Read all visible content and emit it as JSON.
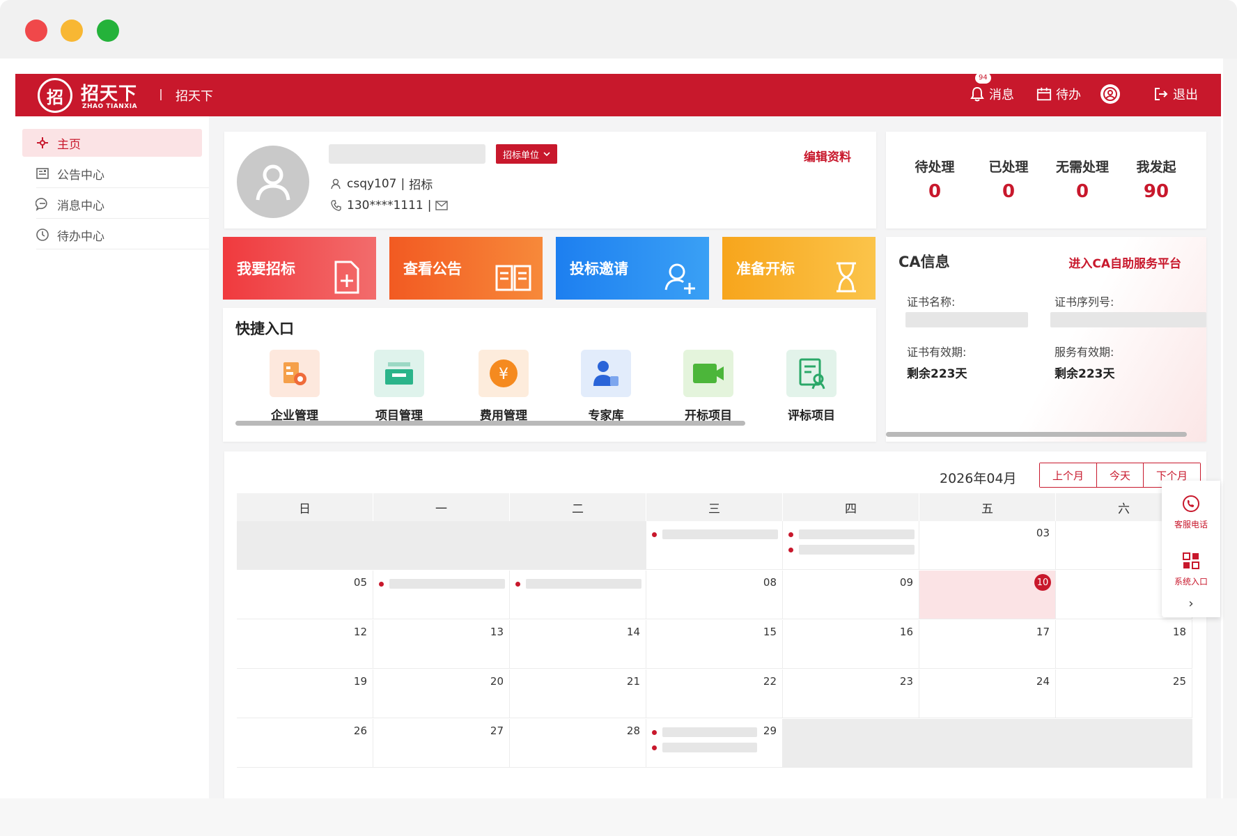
{
  "header": {
    "logo_mark": "招",
    "logo_text": "招天下",
    "logo_sub": "ZHAO TIANXIA",
    "site_name": "招天下",
    "message_badge": "94",
    "message_label": "消息",
    "todo_label": "待办",
    "logout_label": "退出"
  },
  "sidebar": {
    "items": [
      {
        "label": "主页",
        "icon": "home-icon",
        "active": true
      },
      {
        "label": "公告中心",
        "icon": "notice-icon"
      },
      {
        "label": "消息中心",
        "icon": "message-icon"
      },
      {
        "label": "待办中心",
        "icon": "clock-icon"
      }
    ]
  },
  "profile": {
    "role_tag": "招标单位",
    "edit_label": "编辑资料",
    "username": "csqy107",
    "user_type": "招标",
    "phone": "130****1111"
  },
  "stats": [
    {
      "label": "待处理",
      "value": "0"
    },
    {
      "label": "已处理",
      "value": "0"
    },
    {
      "label": "无需处理",
      "value": "0"
    },
    {
      "label": "我发起",
      "value": "90"
    }
  ],
  "tiles": [
    {
      "label": "我要招标",
      "color": "#f0484a",
      "icon": "document-add-icon"
    },
    {
      "label": "查看公告",
      "color": "#f66a2a",
      "icon": "book-icon"
    },
    {
      "label": "投标邀请",
      "color": "#2a8cf0",
      "icon": "user-add-icon"
    },
    {
      "label": "准备开标",
      "color": "#f9a825",
      "icon": "hourglass-icon"
    }
  ],
  "ca": {
    "title": "CA信息",
    "link": "进入CA自助服务平台",
    "cert_name_label": "证书名称:",
    "cert_serial_label": "证书序列号:",
    "cert_valid_label": "证书有效期:",
    "cert_valid_value": "剩余223天",
    "service_valid_label": "服务有效期:",
    "service_valid_value": "剩余223天"
  },
  "quick_entry": {
    "title": "快捷入口",
    "items": [
      {
        "label": "企业管理",
        "icon": "enterprise-icon"
      },
      {
        "label": "项目管理",
        "icon": "project-icon"
      },
      {
        "label": "费用管理",
        "icon": "fee-icon"
      },
      {
        "label": "专家库",
        "icon": "expert-icon"
      },
      {
        "label": "开标项目",
        "icon": "video-icon"
      },
      {
        "label": "评标项目",
        "icon": "review-icon"
      }
    ]
  },
  "calendar": {
    "month": "2026年04月",
    "buttons": [
      "上个月",
      "今天",
      "下个月"
    ],
    "weekdays": [
      "日",
      "一",
      "二",
      "三",
      "四",
      "五",
      "六"
    ],
    "weeks": [
      [
        {
          "d": "",
          "m": 1
        },
        {
          "d": "",
          "m": 1
        },
        {
          "d": "",
          "m": 1
        },
        {
          "d": "",
          "e": 1
        },
        {
          "d": "",
          "e": 2
        },
        {
          "d": "03"
        },
        {
          "d": ""
        }
      ],
      [
        {
          "d": "05"
        },
        {
          "d": "",
          "e": 1
        },
        {
          "d": "",
          "e": 1
        },
        {
          "d": "08"
        },
        {
          "d": "09"
        },
        {
          "d": "10",
          "t": 1
        },
        {
          "d": ""
        }
      ],
      [
        {
          "d": "12"
        },
        {
          "d": "13"
        },
        {
          "d": "14"
        },
        {
          "d": "15"
        },
        {
          "d": "16"
        },
        {
          "d": "17"
        },
        {
          "d": "18"
        }
      ],
      [
        {
          "d": "19"
        },
        {
          "d": "20"
        },
        {
          "d": "21"
        },
        {
          "d": "22"
        },
        {
          "d": "23"
        },
        {
          "d": "24"
        },
        {
          "d": "25"
        }
      ],
      [
        {
          "d": "26"
        },
        {
          "d": "27"
        },
        {
          "d": "28"
        },
        {
          "d": "29",
          "e": 2
        },
        {
          "d": "",
          "m": 1
        },
        {
          "d": "",
          "m": 1
        },
        {
          "d": "",
          "m": 1
        }
      ]
    ]
  },
  "float_panel": {
    "service_label": "客服电话",
    "system_label": "系统入口",
    "arrow": "›"
  }
}
